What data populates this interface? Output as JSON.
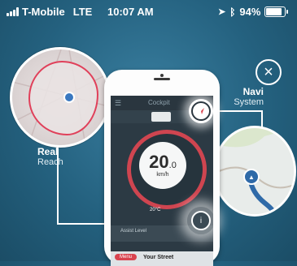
{
  "status_bar": {
    "carrier": "T-Mobile",
    "network": "LTE",
    "time": "10:07 AM",
    "battery_percent": "94%",
    "battery_level": 0.94
  },
  "callouts": {
    "real_reach": {
      "title": "Real",
      "subtitle": "Reach"
    },
    "navi_system": {
      "title": "Navi",
      "subtitle": "System"
    }
  },
  "phone_screen": {
    "title": "Cockpit",
    "speed_value": "20",
    "speed_decimal": ".0",
    "speed_unit": "km/h",
    "temperature": "20°C",
    "assist_label": "Assist Level",
    "street_chip": "Menu",
    "street_name": "Your Street"
  },
  "icons": {
    "close": "close-icon",
    "navigation": "navigation-arrow-icon",
    "info": "info-icon",
    "map_pin": "map-pin-icon"
  },
  "colors": {
    "accent_red": "#d9434f",
    "background": "#24617f",
    "route_blue": "#2f6aa8"
  }
}
